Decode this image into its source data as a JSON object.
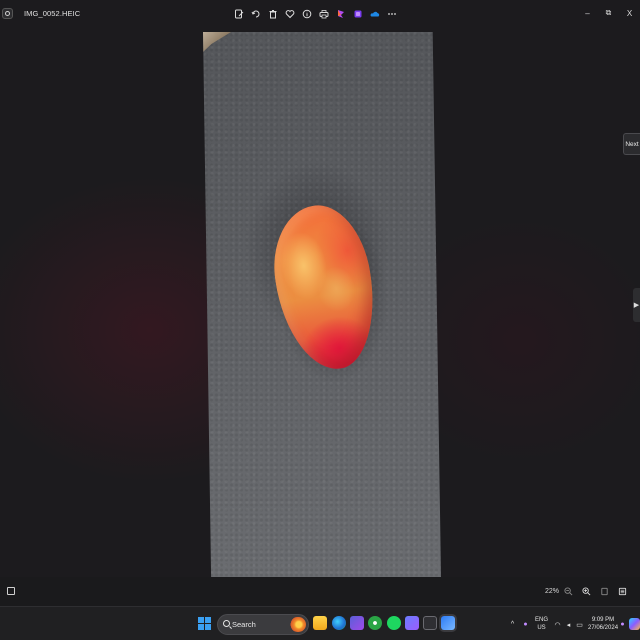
{
  "window": {
    "file_name": "IMG_0052.HEIC",
    "toolbar": [
      {
        "name": "edit-icon"
      },
      {
        "name": "rotate-icon"
      },
      {
        "name": "delete-icon"
      },
      {
        "name": "favorite-icon"
      },
      {
        "name": "info-icon"
      },
      {
        "name": "print-icon"
      },
      {
        "name": "clipchamp-icon"
      },
      {
        "name": "designer-icon"
      },
      {
        "name": "onedrive-icon"
      },
      {
        "name": "more-icon"
      }
    ],
    "controls": {
      "minimize": "–",
      "maximize": "⧉",
      "close": "X"
    }
  },
  "viewer": {
    "next_label": "Next",
    "side_arrow": "▶"
  },
  "statusbar": {
    "zoom_label": "22%"
  },
  "taskbar": {
    "search_placeholder": "Search",
    "language_line1": "ENG",
    "language_line2": "US",
    "time": "9:09 PM",
    "date": "27/06/2024",
    "tray_chevron": "^",
    "colors": {
      "start": "#3aa0f3",
      "accent": "#f08a2a"
    }
  }
}
